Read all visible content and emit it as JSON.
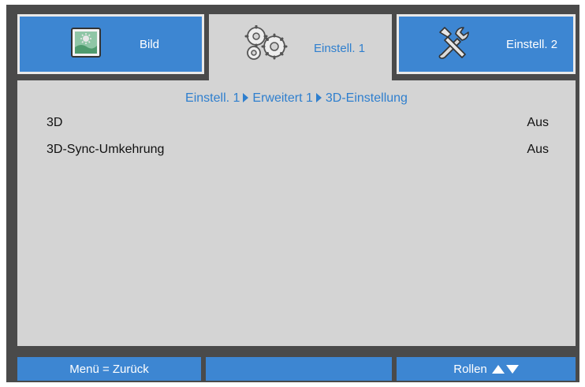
{
  "tabs": [
    {
      "label": "Bild",
      "icon": "picture-icon",
      "active": false
    },
    {
      "label": "Einstell. 1",
      "icon": "gears-icon",
      "active": true
    },
    {
      "label": "Einstell. 2",
      "icon": "tools-icon",
      "active": false
    }
  ],
  "breadcrumb": [
    "Einstell. 1",
    "Erweitert 1",
    "3D-Einstellung"
  ],
  "settings": [
    {
      "name": "3D",
      "value": "Aus"
    },
    {
      "name": "3D-Sync-Umkehrung",
      "value": "Aus"
    }
  ],
  "footer": {
    "back_label": "Menü = Zurück",
    "middle_label": "",
    "scroll_label": "Rollen"
  },
  "colors": {
    "accent": "#3d86d2",
    "panel": "#d4d4d4",
    "frame": "#4a4a4a",
    "active_text": "#2f7fce"
  }
}
